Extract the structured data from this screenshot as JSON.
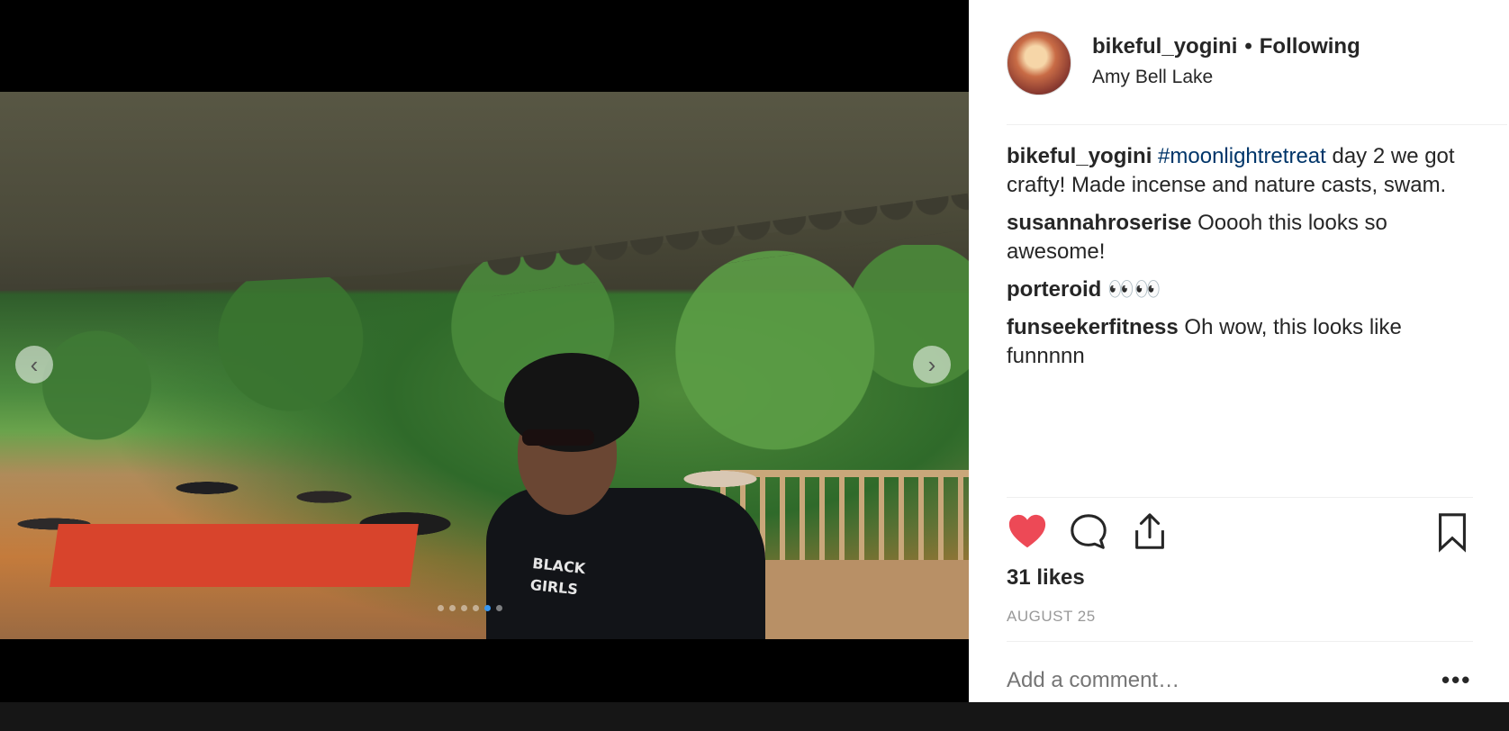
{
  "post": {
    "username": "bikeful_yogini",
    "separator": "•",
    "follow_status": "Following",
    "location": "Amy Bell Lake",
    "caption": {
      "username": "bikeful_yogini",
      "hashtag": "#moonlightretreat",
      "text": " day 2 we got crafty! Made incense and nature casts, swam."
    },
    "comments": [
      {
        "username": "susannahroserise",
        "text": " Ooooh this looks so awesome!"
      },
      {
        "username": "porteroid",
        "text": " 👀👀"
      },
      {
        "username": "funseekerfitness",
        "text": " Oh wow, this looks like funnnnn"
      }
    ],
    "likes": "31 likes",
    "date": "AUGUST 25",
    "add_comment_placeholder": "Add a comment…",
    "more_label": "•••"
  },
  "photo": {
    "shirt_text_line1": "BLACK",
    "shirt_text_line2": "GIRLS",
    "carousel_dots": 6,
    "active_dot": 4
  },
  "icons": {
    "like": "heart-icon",
    "comment": "speech-bubble-icon",
    "share": "share-icon",
    "save": "bookmark-icon",
    "prev": "chevron-left-icon",
    "next": "chevron-right-icon"
  },
  "colors": {
    "like_red": "#ed4956",
    "hashtag_blue": "#003569",
    "meta_gray": "#999999",
    "active_dot": "#3897f0"
  }
}
